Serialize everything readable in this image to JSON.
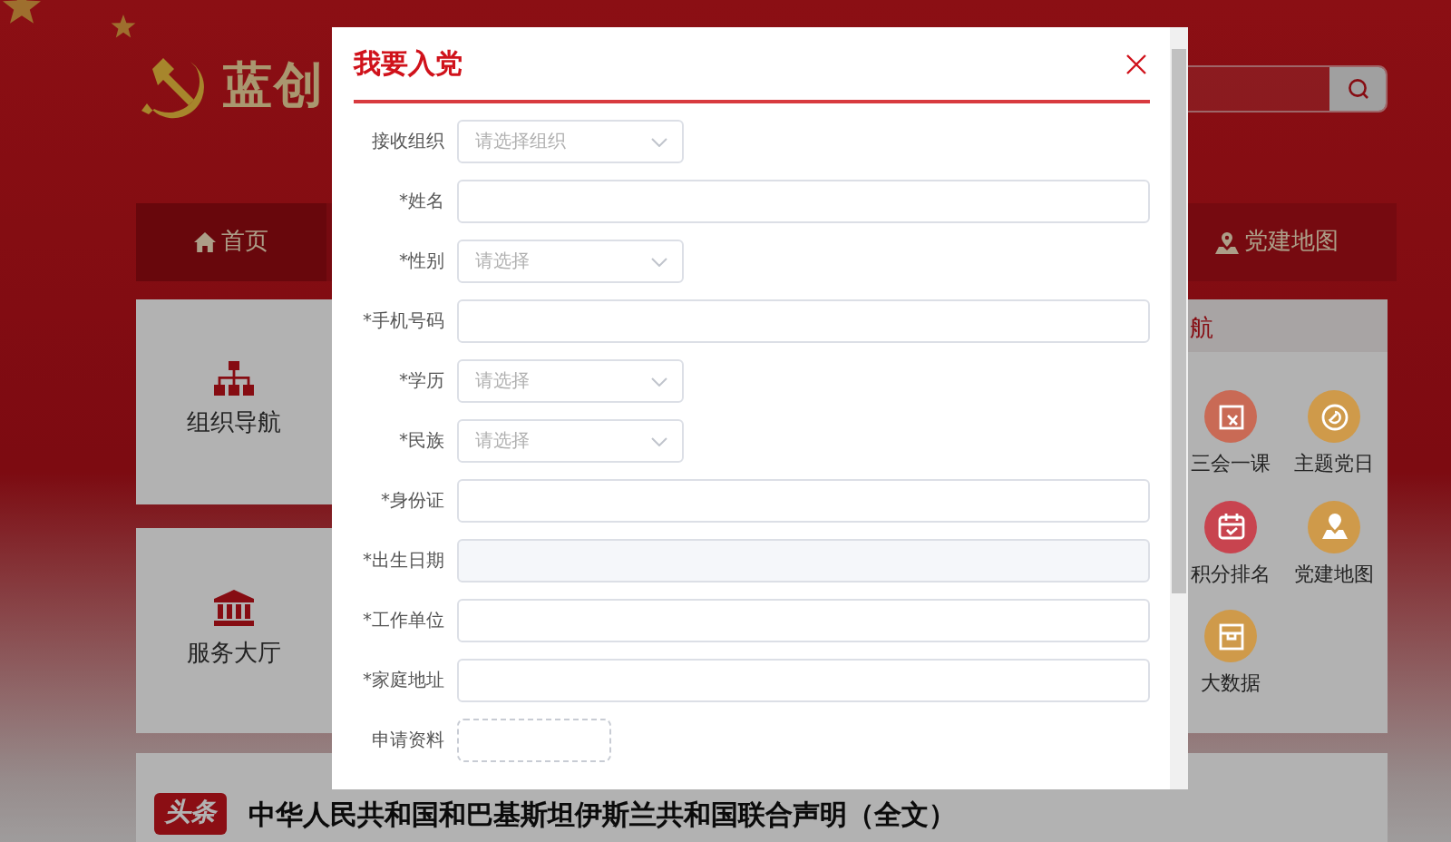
{
  "header": {
    "title": "蓝创"
  },
  "nav": [
    {
      "label": "首页",
      "kind": "home",
      "selected": true
    },
    {
      "label": "党建地图",
      "kind": "map",
      "selected": false
    }
  ],
  "side_cards": [
    {
      "label": "组织导航",
      "kind": "org"
    },
    {
      "label": "服务大厅",
      "kind": "hall"
    }
  ],
  "panel": {
    "title": "航",
    "items": [
      {
        "label": "三会一课",
        "kind": "board",
        "color": "#c96a55"
      },
      {
        "label": "主题党日",
        "kind": "badge",
        "color": "#cf9a4a"
      },
      {
        "label": "积分排名",
        "kind": "calendar",
        "color": "#c8444f"
      },
      {
        "label": "党建地图",
        "kind": "map",
        "color": "#cf9a4a"
      },
      {
        "label": "大数据",
        "kind": "box",
        "color": "#cf9a4a"
      }
    ]
  },
  "news": {
    "badge": "头条",
    "headline": "中华人民共和国和巴基斯坦伊斯兰共和国联合声明（全文）"
  },
  "modal": {
    "title": "我要入党",
    "fields": [
      {
        "label": "接收组织",
        "kind": "select",
        "placeholder": "请选择组织"
      },
      {
        "label": "*姓名",
        "kind": "text"
      },
      {
        "label": "*性别",
        "kind": "select",
        "placeholder": "请选择"
      },
      {
        "label": "*手机号码",
        "kind": "text"
      },
      {
        "label": "*学历",
        "kind": "select",
        "placeholder": "请选择"
      },
      {
        "label": "*民族",
        "kind": "select",
        "placeholder": "请选择"
      },
      {
        "label": "*身份证",
        "kind": "text"
      },
      {
        "label": "*出生日期",
        "kind": "date"
      },
      {
        "label": "*工作单位",
        "kind": "text"
      },
      {
        "label": "*家庭地址",
        "kind": "text"
      },
      {
        "label": "申请资料",
        "kind": "upload"
      }
    ]
  }
}
